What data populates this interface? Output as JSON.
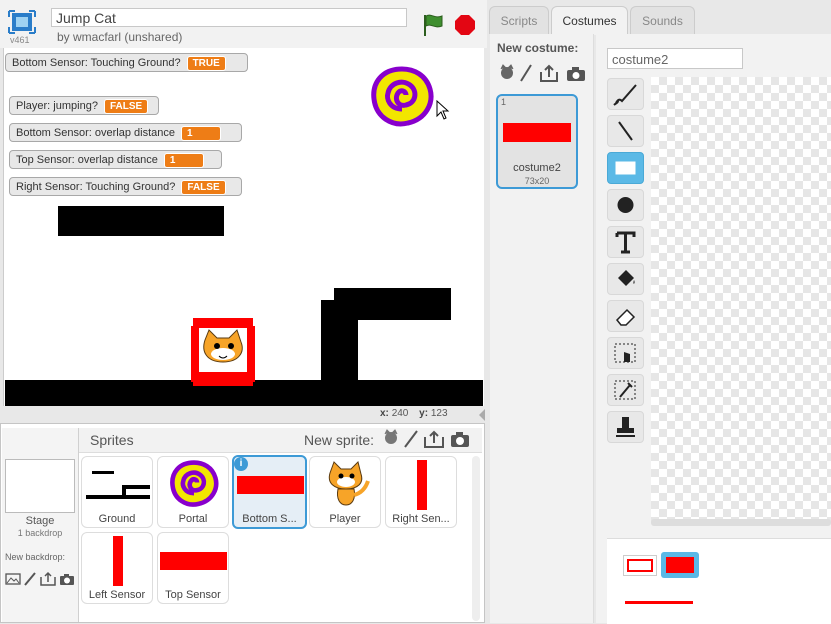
{
  "header": {
    "version": "v461",
    "project_title": "Jump Cat",
    "author": "by wmacfarl (unshared)"
  },
  "monitors": [
    {
      "label": "Bottom Sensor: Touching Ground?",
      "value": "TRUE"
    },
    {
      "label": "Player: jumping?",
      "value": "FALSE"
    },
    {
      "label": "Bottom Sensor: overlap distance",
      "value": "1"
    },
    {
      "label": "Top Sensor: overlap distance",
      "value": "1"
    },
    {
      "label": "Right Sensor: Touching Ground?",
      "value": "FALSE"
    }
  ],
  "coords": {
    "x_label": "x:",
    "x": "240",
    "y_label": "y:",
    "y": "123"
  },
  "sprites_pane": {
    "title": "Sprites",
    "new_sprite_label": "New sprite:",
    "stage_label": "Stage",
    "stage_backdrops": "1 backdrop",
    "new_backdrop_label": "New backdrop:",
    "sprites": [
      {
        "name": "Ground"
      },
      {
        "name": "Portal"
      },
      {
        "name": "Bottom S..."
      },
      {
        "name": "Player"
      },
      {
        "name": "Right Sen..."
      },
      {
        "name": "Left Sensor"
      },
      {
        "name": "Top Sensor"
      }
    ]
  },
  "tabs": [
    "Scripts",
    "Costumes",
    "Sounds"
  ],
  "costumes": {
    "new_costume_label": "New costume:",
    "items": [
      {
        "index": "1",
        "name": "costume2",
        "size": "73x20"
      }
    ]
  },
  "editor": {
    "costume_name_value": "costume2",
    "tools": [
      "brush-icon",
      "line-icon",
      "rectangle-icon",
      "ellipse-icon",
      "text-icon",
      "fill-icon",
      "eraser-icon",
      "select-icon",
      "duplicate-icon",
      "stamp-icon"
    ]
  },
  "colors": {
    "sprite_red": "#ff0000",
    "accent_blue": "#3d9ad6",
    "monitor_orange": "#ee7d16",
    "flag_green": "#2c7a2c",
    "stop_red": "#e30613"
  }
}
